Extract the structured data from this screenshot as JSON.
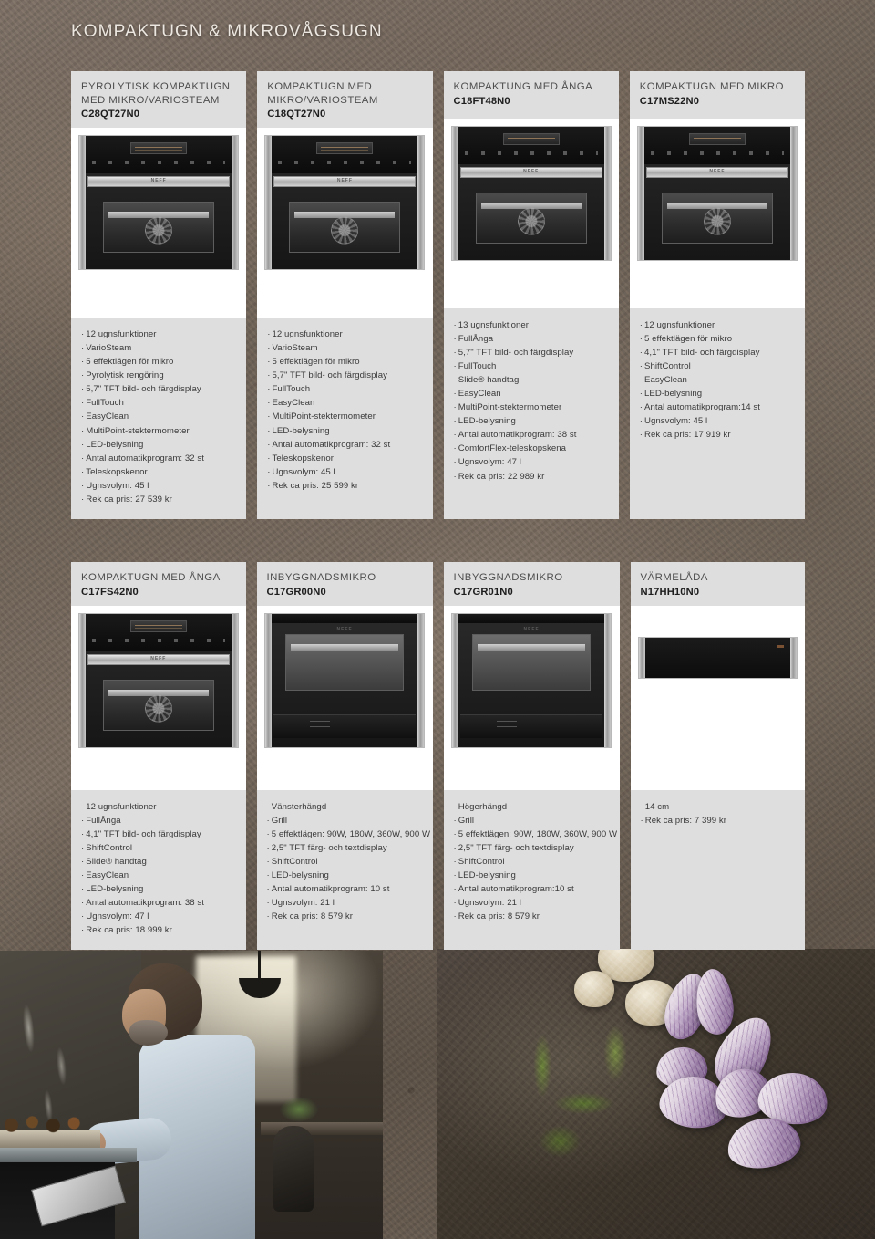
{
  "page": {
    "title": "KOMPAKTUGN & MIKROVÅGSUGN"
  },
  "rows": [
    {
      "products": [
        {
          "title": "PYROLYTISK KOMPAKTUGN MED MIKRO/VARIOSTEAM",
          "model": "C28QT27N0",
          "image_kind": "oven",
          "specs": [
            "12 ugnsfunktioner",
            "VarioSteam",
            "5 effektlägen för mikro",
            "Pyrolytisk rengöring",
            "5,7\" TFT bild- och färgdisplay",
            "FullTouch",
            "EasyClean",
            "MultiPoint-stektermometer",
            "LED-belysning",
            "Antal automatikprogram: 32 st",
            "Teleskopskenor",
            "Ugnsvolym: 45 l",
            "Rek ca pris: 27 539 kr"
          ]
        },
        {
          "title": "KOMPAKTUGN MED MIKRO/VARIOSTEAM",
          "model": "C18QT27N0",
          "image_kind": "oven",
          "specs": [
            "12 ugnsfunktioner",
            "VarioSteam",
            "5 effektlägen för mikro",
            "5,7\" TFT bild- och färgdisplay",
            "FullTouch",
            "EasyClean",
            "MultiPoint-stektermometer",
            "LED-belysning",
            "Antal automatikprogram: 32 st",
            "Teleskopskenor",
            "Ugnsvolym: 45 l",
            "Rek ca pris: 25 599 kr"
          ]
        },
        {
          "title": "KOMPAKTUNG MED ÅNGA",
          "model": "C18FT48N0",
          "image_kind": "oven",
          "specs": [
            "13 ugnsfunktioner",
            "FullÅnga",
            "5,7\" TFT bild- och färgdisplay",
            "FullTouch",
            "Slide® handtag",
            "EasyClean",
            "MultiPoint-stektermometer",
            "LED-belysning",
            "Antal automatikprogram: 38 st",
            "ComfortFlex-teleskopskena",
            "Ugnsvolym: 47 l",
            "Rek ca pris: 22 989 kr"
          ]
        },
        {
          "title": "KOMPAKTUGN MED MIKRO",
          "model": "C17MS22N0",
          "image_kind": "oven",
          "specs": [
            "12 ugnsfunktioner",
            "5 effektlägen för mikro",
            "4,1\" TFT bild- och färgdisplay",
            "ShiftControl",
            "EasyClean",
            "LED-belysning",
            "Antal automatikprogram:14 st",
            "Ugnsvolym: 45 l",
            "Rek ca pris: 17 919 kr"
          ]
        }
      ]
    },
    {
      "products": [
        {
          "title": "KOMPAKTUGN MED ÅNGA",
          "model": "C17FS42N0",
          "image_kind": "oven",
          "specs": [
            "12 ugnsfunktioner",
            "FullÅnga",
            "4,1\" TFT bild- och färgdisplay",
            "ShiftControl",
            "Slide® handtag",
            "EasyClean",
            "LED-belysning",
            "Antal automatikprogram: 38 st",
            "Ugnsvolym: 47 l",
            "Rek ca pris: 18 999 kr"
          ]
        },
        {
          "title": "INBYGGNADSMIKRO",
          "model": "C17GR00N0",
          "image_kind": "microwave",
          "specs": [
            "Vänsterhängd",
            "Grill",
            "5 effektlägen: 90W, 180W, 360W, 900 W",
            "2,5\" TFT färg- och textdisplay",
            "ShiftControl",
            "LED-belysning",
            "Antal automatikprogram: 10 st",
            "Ugnsvolym: 21 l",
            "Rek ca pris: 8 579 kr"
          ]
        },
        {
          "title": "INBYGGNADSMIKRO",
          "model": "C17GR01N0",
          "image_kind": "microwave",
          "specs": [
            "Högerhängd",
            "Grill",
            "5 effektlägen: 90W, 180W, 360W, 900 W",
            "2,5\" TFT färg- och textdisplay",
            "ShiftControl",
            "LED-belysning",
            "Antal automatikprogram:10 st",
            "Ugnsvolym: 21 l",
            "Rek ca pris: 8 579 kr"
          ]
        },
        {
          "title": "VÄRMELÅDA",
          "model": "N17HH10N0",
          "image_kind": "drawer",
          "specs": [
            "14 cm",
            "Rek ca pris: 7 399 kr"
          ]
        }
      ]
    }
  ],
  "photos": {
    "chef": "chef-plating-food-photo",
    "vegetables": "shallots-herbs-mushrooms-photo"
  },
  "colors": {
    "card_header": "#dedede",
    "card_body": "#dedede",
    "title_text": "#ece7e0",
    "model_text": "#1d1d1d"
  }
}
